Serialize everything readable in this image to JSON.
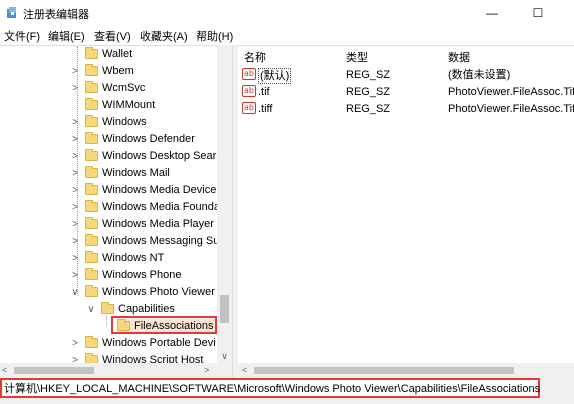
{
  "window": {
    "title": "注册表编辑器",
    "minimize_glyph": "—",
    "maximize_glyph": "☐"
  },
  "menu": [
    "文件(F)",
    "编辑(E)",
    "查看(V)",
    "收藏夹(A)",
    "帮助(H)"
  ],
  "tree": {
    "items": [
      {
        "label": "Wallet",
        "expander": ""
      },
      {
        "label": "Wbem",
        "expander": ">"
      },
      {
        "label": "WcmSvc",
        "expander": ">"
      },
      {
        "label": "WIMMount",
        "expander": ""
      },
      {
        "label": "Windows",
        "expander": ">"
      },
      {
        "label": "Windows Defender",
        "expander": ">"
      },
      {
        "label": "Windows Desktop Sear",
        "expander": ">"
      },
      {
        "label": "Windows Mail",
        "expander": ">"
      },
      {
        "label": "Windows Media Device",
        "expander": ">"
      },
      {
        "label": "Windows Media Founda",
        "expander": ">"
      },
      {
        "label": "Windows Media Player",
        "expander": ">"
      },
      {
        "label": "Windows Messaging Su",
        "expander": ">"
      },
      {
        "label": "Windows NT",
        "expander": ">"
      },
      {
        "label": "Windows Phone",
        "expander": ">"
      },
      {
        "label": "Windows Photo Viewer",
        "expander": "∨"
      },
      {
        "label": "Capabilities",
        "expander": "∨"
      },
      {
        "label": "FileAssociations",
        "expander": ""
      },
      {
        "label": "Windows Portable Devi",
        "expander": ">"
      },
      {
        "label": "Windows Script Host",
        "expander": ">"
      }
    ]
  },
  "list": {
    "columns": [
      "名称",
      "类型",
      "数据"
    ],
    "rows": [
      {
        "icon": "ab",
        "name": "(默认)",
        "type": "REG_SZ",
        "data": "(数值未设置)"
      },
      {
        "icon": "ab",
        "name": ".tif",
        "type": "REG_SZ",
        "data": "PhotoViewer.FileAssoc.Tiff"
      },
      {
        "icon": "ab",
        "name": ".tiff",
        "type": "REG_SZ",
        "data": "PhotoViewer.FileAssoc.Tiff"
      }
    ]
  },
  "status": {
    "path": "计算机\\HKEY_LOCAL_MACHINE\\SOFTWARE\\Microsoft\\Windows Photo Viewer\\Capabilities\\FileAssociations"
  },
  "colors": {
    "highlight_border": "#e53935",
    "folder": "#f6d77a"
  }
}
